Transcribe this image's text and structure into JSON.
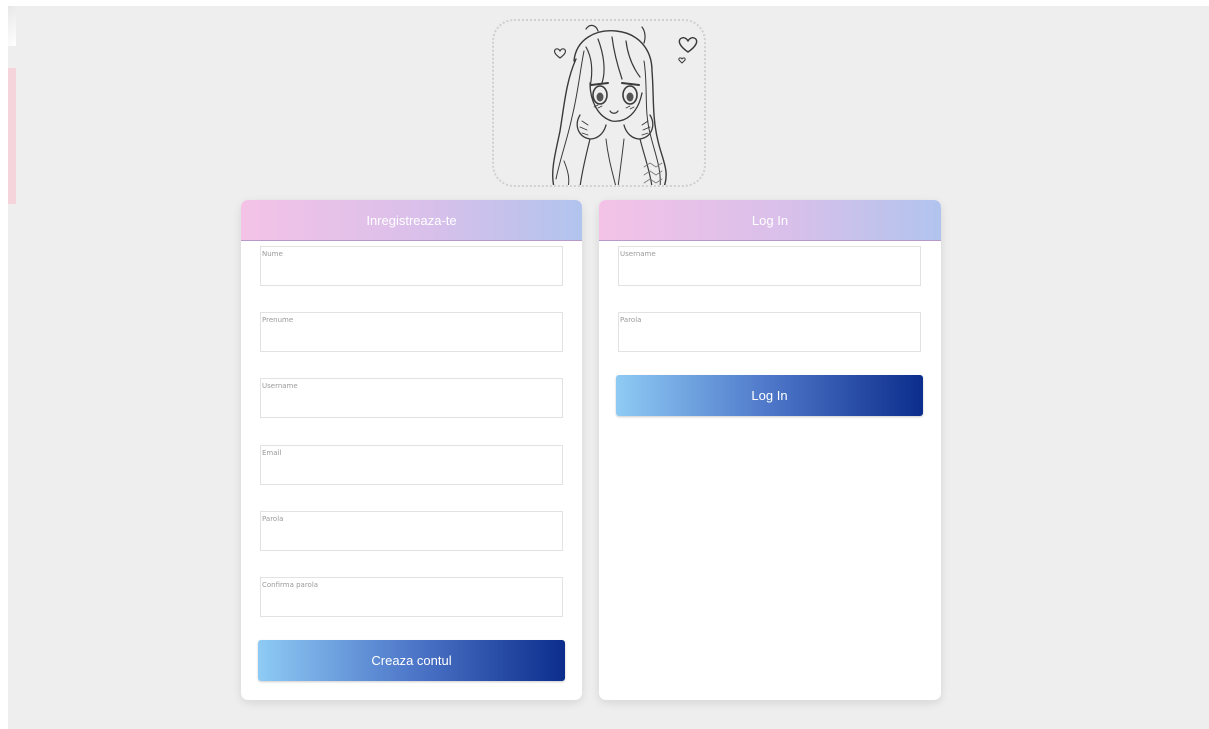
{
  "register": {
    "title": "Inregistreaza-te",
    "fields": [
      {
        "label": "Nume",
        "value": ""
      },
      {
        "label": "Prenume",
        "value": ""
      },
      {
        "label": "Username",
        "value": ""
      },
      {
        "label": "Email",
        "value": ""
      },
      {
        "label": "Parola",
        "value": ""
      },
      {
        "label": "Confirma parola",
        "value": ""
      }
    ],
    "submit_label": "Creaza contul"
  },
  "login": {
    "title": "Log In",
    "fields": [
      {
        "label": "Username",
        "value": ""
      },
      {
        "label": "Parola",
        "value": ""
      }
    ],
    "submit_label": "Log In"
  },
  "colors": {
    "background": "#eeeeee",
    "card": "#ffffff",
    "header_gradient_start": "#f4c2e7",
    "header_gradient_end": "#b1c4ee",
    "button_gradient_start": "#8ecbf4",
    "button_gradient_end": "#0c2d8c"
  },
  "icons": {
    "avatar": "anime-girl-sketch-avatar",
    "decoration": "heart-icon"
  }
}
